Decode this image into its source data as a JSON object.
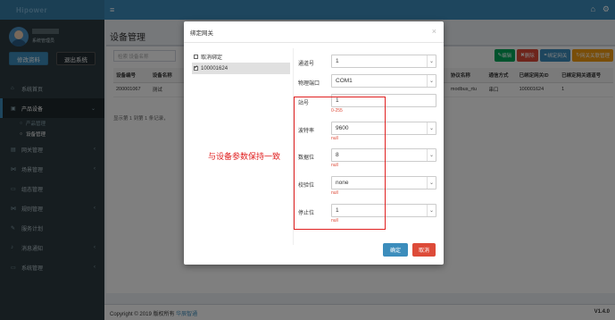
{
  "header": {
    "logo": "Hipower",
    "menu_icon": "hamburger-icon"
  },
  "user": {
    "role": "系统管理员",
    "info_button": "修改资料",
    "logout_button": "退出系统"
  },
  "sidebar": {
    "items": [
      {
        "label": "系统首页",
        "icon": "home-icon"
      },
      {
        "label": "产品设备",
        "icon": "product-icon",
        "active": true,
        "children": [
          {
            "label": "产品管理"
          },
          {
            "label": "设备管理",
            "active": true
          }
        ]
      },
      {
        "label": "网关管理",
        "icon": "gateway-icon"
      },
      {
        "label": "场景管理",
        "icon": "scene-icon"
      },
      {
        "label": "组态管理",
        "icon": "monitor-icon"
      },
      {
        "label": "规则管理",
        "icon": "rule-icon"
      },
      {
        "label": "服务计划",
        "icon": "wrench-icon"
      },
      {
        "label": "消息通知",
        "icon": "bell-icon"
      },
      {
        "label": "系统管理",
        "icon": "desktop-icon"
      }
    ]
  },
  "main": {
    "title": "设备管理",
    "search_placeholder": "检索 设备名称",
    "toolbar": [
      "编辑",
      "删除",
      "绑定网关",
      "网关关联管理"
    ],
    "table": {
      "headers": [
        "设备编号",
        "设备名称",
        "协议名称",
        "通信方式",
        "已绑定网关ID",
        "已绑定网关通道号"
      ],
      "rows": [
        [
          "200001067",
          "测试",
          "modbus_rtu",
          "串口",
          "100001624",
          "1"
        ]
      ]
    },
    "pager": "显示第 1 到第 1 条记录，"
  },
  "footer": {
    "copyright": "Copyright © 2019 版权所有",
    "company": "华辰智通",
    "version": "V1.4.0"
  },
  "modal": {
    "title": "绑定网关",
    "gateways": [
      {
        "label": "取消绑定",
        "checked": false
      },
      {
        "label": "100001624",
        "checked": true
      }
    ],
    "fields": [
      {
        "label": "通道号",
        "value": "1",
        "type": "select"
      },
      {
        "label": "物理端口",
        "value": "COM1",
        "type": "select"
      },
      {
        "label": "站号",
        "value": "1",
        "type": "input",
        "hint": "0-255"
      },
      {
        "label": "波特率",
        "value": "9600",
        "type": "select",
        "hint": "null"
      },
      {
        "label": "数据位",
        "value": "8",
        "type": "select",
        "hint": "null"
      },
      {
        "label": "校验位",
        "value": "none",
        "type": "select",
        "hint": "null"
      },
      {
        "label": "停止位",
        "value": "1",
        "type": "select",
        "hint": "null"
      }
    ],
    "ok_button": "确定",
    "cancel_button": "取消"
  },
  "annotation": "与设备参数保持一致",
  "colors": {
    "brand": "#3c8dbc",
    "sidebar": "#2c3b41",
    "danger": "#dd4b39",
    "annotation": "#e02020"
  }
}
